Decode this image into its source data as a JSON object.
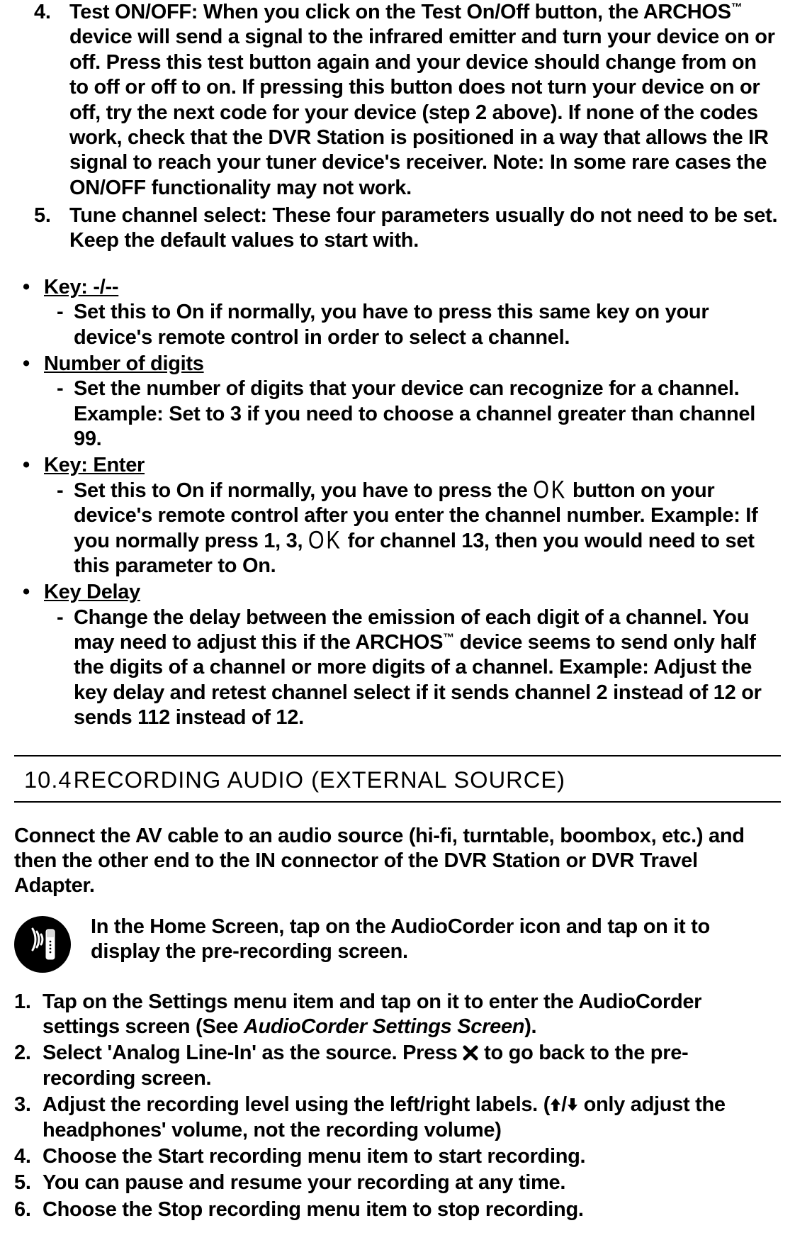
{
  "top_list": {
    "item4": {
      "num": "4.",
      "text_before_tm": "Test ON/OFF: When you click on the Test On/Off button, the ARCHOS",
      "tm": "™",
      "text_after_tm": " device will send a signal to the infrared emitter and turn your device on or off. Press this test button again and your device should change from on to off or off to on. If pressing this button does not turn your device on or off, try the next code for your device (step 2 above). If none of the codes work, check that the DVR Station is positioned in a way that allows the IR signal to reach your tuner de­vice's receiver. Note: In some rare cases the ON/OFF functionality may not work."
    },
    "item5": {
      "num": "5.",
      "text": "Tune channel select: These four parameters usually do not need to be set. Keep the default values to start with."
    }
  },
  "key_params": {
    "key1": {
      "title": "Key: -/--",
      "desc": "Set this to On if normally, you have to press this same key on your device's re­mote control in order to select a channel."
    },
    "key2": {
      "title": "Number of digits",
      "desc": "Set the number of digits that your device can recognize for a channel. Example: Set to 3 if you need to choose a channel greater than channel 99."
    },
    "key3": {
      "title": "Key: Enter",
      "desc_part1": "Set this to On if normally, you have to press the ",
      "ok": "OK",
      "desc_part2": " button on your device's re­mote control after you enter the channel number. Example: If you normally press 1, 3, ",
      "desc_part3": " for channel 13, then you would need to set this parameter to On."
    },
    "key4": {
      "title": "Key Delay",
      "desc_part1": "Change the delay between the emission of each digit of a channel. You may need to adjust this if the ARCHOS",
      "tm": "™",
      "desc_part2": " device seems to send only half the digits of a channel or more digits of a channel. Example: Adjust the key delay and retest channel select if it sends channel 2 instead of 12 or sends 112 instead of 12."
    }
  },
  "section": {
    "num": "10.4",
    "title": "RECORDING AUDIO (EXTERNAL SOURCE)"
  },
  "audio": {
    "intro": "Connect the AV cable to an audio source (hi-fi, turntable, boombox, etc.) and then the other end to the IN connector of the DVR Station or DVR Travel Adapter.",
    "iconrow": "In the Home Screen, tap on the AudioCorder icon and tap on it to display the pre-recording screen.",
    "steps": {
      "s1": {
        "num": "1.",
        "part1": "Tap on the Settings menu item and tap on it to enter the AudioCorder settings screen (See ",
        "italic": "AudioCorder Settings Screen",
        "part2": ")."
      },
      "s2": {
        "num": "2.",
        "part1": "Select 'Analog Line-In' as the source. Press ",
        "part2": " to go back to the pre-recording screen."
      },
      "s3": {
        "num": "3.",
        "part1": "Adjust the recording level using the left/right labels. (",
        "part2": " only adjust the head­phones' volume, not the recording volume)"
      },
      "s4": {
        "num": "4.",
        "text": "Choose the Start recording menu item to start recording."
      },
      "s5": {
        "num": "5.",
        "text": "You can pause and resume your recording at any time."
      },
      "s6": {
        "num": "6.",
        "text": "Choose the Stop recording menu item to stop recording."
      }
    }
  },
  "glyphs": {
    "bullet": "•",
    "dash": "-",
    "slash": "/"
  }
}
